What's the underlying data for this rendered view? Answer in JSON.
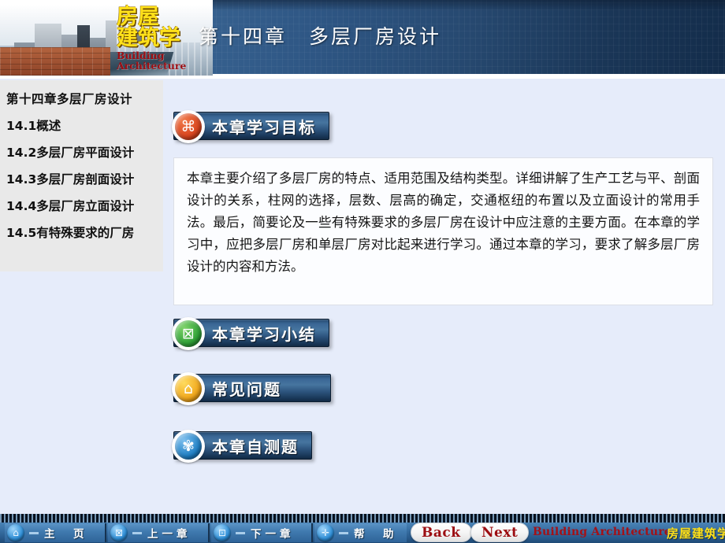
{
  "header": {
    "title": "第十四章　多层厂房设计",
    "logo_cn": "房屋\n建筑学",
    "logo_en": "Building\nArchitecture"
  },
  "sidebar": {
    "items": [
      {
        "label": "第十四章多层厂房设计"
      },
      {
        "label": "14.1概述"
      },
      {
        "label": "14.2多层厂房平面设计"
      },
      {
        "label": "14.3多层厂房剖面设计"
      },
      {
        "label": "14.4多层厂房立面设计"
      },
      {
        "label": "14.5有特殊要求的厂房"
      }
    ]
  },
  "main": {
    "buttons": [
      {
        "label": "本章学习目标",
        "icon": "command-icon",
        "icon_glyph": "⌘",
        "icon_color": "#d8431d"
      },
      {
        "label": "本章学习小结",
        "icon": "notes-icon",
        "icon_glyph": "⊠",
        "icon_color": "#2fa137"
      },
      {
        "label": "常见问题",
        "icon": "question-person-icon",
        "icon_glyph": "⌂",
        "icon_color": "#f0a61b"
      },
      {
        "label": "本章自测题",
        "icon": "quiz-icon",
        "icon_glyph": "✾",
        "icon_color": "#1f7fc4"
      }
    ],
    "body_text": "本章主要介绍了多层厂房的特点、适用范围及结构类型。详细讲解了生产工艺与平、剖面设计的关系，柱网的选择，层数、层高的确定，交通枢纽的布置以及立面设计的常用手法。最后，简要论及一些有特殊要求的多层厂房在设计中应注意的主要方面。在本章的学习中，应把多层厂房和单层厂房对比起来进行学习。通过本章的学习，要求了解多层厂房设计的内容和方法。"
  },
  "footer": {
    "nav": [
      {
        "label": "主　页",
        "icon": "home-icon",
        "icon_glyph": "⌂"
      },
      {
        "label": "上一章",
        "icon": "prev-chapter-icon",
        "icon_glyph": "⊠"
      },
      {
        "label": "下一章",
        "icon": "next-chapter-icon",
        "icon_glyph": "⊡"
      },
      {
        "label": "帮　助",
        "icon": "help-icon",
        "icon_glyph": "✛"
      }
    ],
    "back_label": "Back",
    "next_label": "Next",
    "brand_en": "Building Architecture",
    "brand_cn": "房屋建筑学"
  },
  "colors": {
    "header_blue": "#2e5684",
    "button_blue": "#3a6695",
    "page_bg": "#e6ecfa",
    "sidebar_bg": "#e9e9e9",
    "brand_yellow": "#ffe11a",
    "brand_red": "#9c0d12"
  }
}
